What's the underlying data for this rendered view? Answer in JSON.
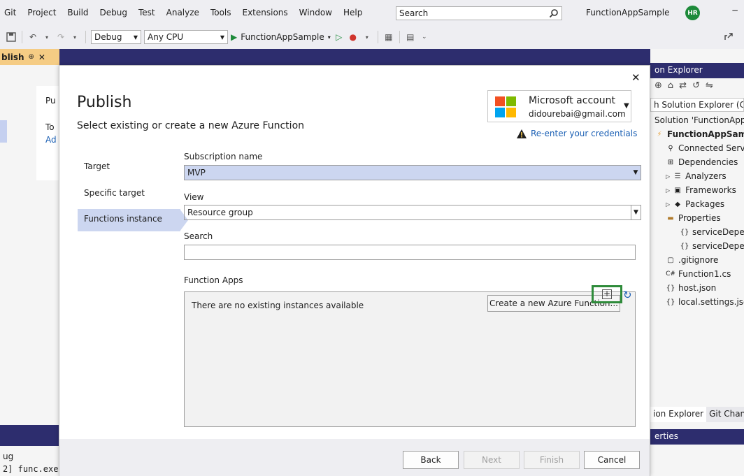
{
  "menu": {
    "items": [
      "Git",
      "Project",
      "Build",
      "Debug",
      "Test",
      "Analyze",
      "Tools",
      "Extensions",
      "Window",
      "Help"
    ]
  },
  "search": {
    "placeholder": "Search"
  },
  "app_name": "FunctionAppSample",
  "avatar_initials": "HR",
  "toolbar": {
    "config": "Debug",
    "platform": "Any CPU",
    "run_target": "FunctionAppSample"
  },
  "doc_tab": {
    "label": "blish",
    "pin": "⊕",
    "close": "✕"
  },
  "bg": {
    "pub_fragment": "Pu",
    "to_fragment": "To",
    "ad_fragment": "Ad"
  },
  "output": {
    "label": "ug",
    "line": "2] func.exe"
  },
  "solution_explorer": {
    "title": "on Explorer",
    "search": "h Solution Explorer (Ctr",
    "items": [
      "Solution 'FunctionApp",
      "FunctionAppSamp",
      "Connected Serv",
      "Dependencies",
      "Analyzers",
      "Frameworks",
      "Packages",
      "Properties",
      "serviceDeper",
      "serviceDeper",
      ".gitignore",
      "Function1.cs",
      "host.json",
      "local.settings.jsc"
    ],
    "tabs": [
      "ion Explorer",
      "Git Chan"
    ],
    "props_title": "erties"
  },
  "dialog": {
    "title": "Publish",
    "subtitle": "Select existing or create a new Azure Function",
    "account_name": "Microsoft account",
    "account_email": "didourebai@gmail.com",
    "reenter": "Re-enter your credentials",
    "nav": [
      "Target",
      "Specific target",
      "Functions instance"
    ],
    "subscription_label": "Subscription name",
    "subscription_value": "MVP",
    "view_label": "View",
    "view_value": "Resource group",
    "search_label": "Search",
    "function_apps_label": "Function Apps",
    "no_instances": "There are no existing instances available",
    "create_new": "Create a new Azure Function...",
    "buttons": {
      "back": "Back",
      "next": "Next",
      "finish": "Finish",
      "cancel": "Cancel"
    }
  },
  "colors": {
    "accent": "#2d2d6e",
    "selection": "#ccd6f0",
    "highlight_box": "#2e8b3a",
    "link": "#1a5fb4"
  }
}
